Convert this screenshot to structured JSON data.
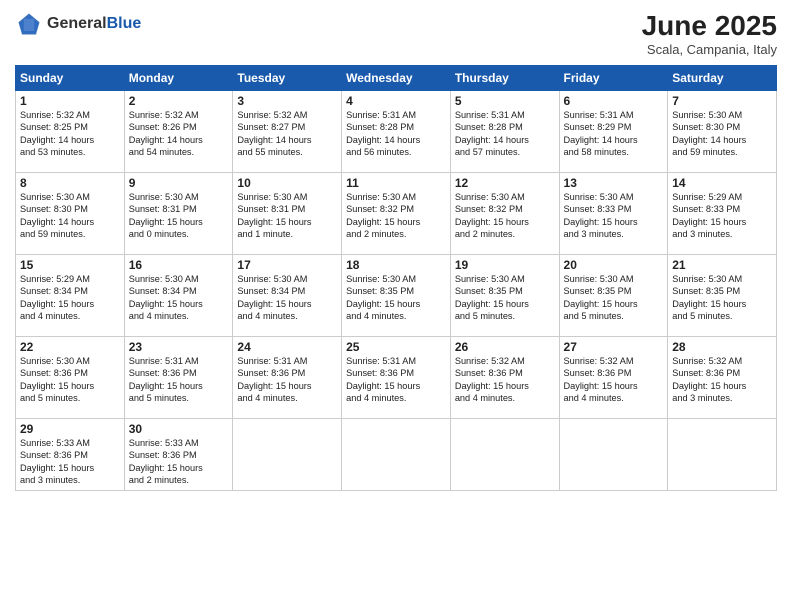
{
  "header": {
    "logo_general": "General",
    "logo_blue": "Blue",
    "month_year": "June 2025",
    "location": "Scala, Campania, Italy"
  },
  "days_of_week": [
    "Sunday",
    "Monday",
    "Tuesday",
    "Wednesday",
    "Thursday",
    "Friday",
    "Saturday"
  ],
  "weeks": [
    [
      {
        "day": "1",
        "text": "Sunrise: 5:32 AM\nSunset: 8:25 PM\nDaylight: 14 hours\nand 53 minutes."
      },
      {
        "day": "2",
        "text": "Sunrise: 5:32 AM\nSunset: 8:26 PM\nDaylight: 14 hours\nand 54 minutes."
      },
      {
        "day": "3",
        "text": "Sunrise: 5:32 AM\nSunset: 8:27 PM\nDaylight: 14 hours\nand 55 minutes."
      },
      {
        "day": "4",
        "text": "Sunrise: 5:31 AM\nSunset: 8:28 PM\nDaylight: 14 hours\nand 56 minutes."
      },
      {
        "day": "5",
        "text": "Sunrise: 5:31 AM\nSunset: 8:28 PM\nDaylight: 14 hours\nand 57 minutes."
      },
      {
        "day": "6",
        "text": "Sunrise: 5:31 AM\nSunset: 8:29 PM\nDaylight: 14 hours\nand 58 minutes."
      },
      {
        "day": "7",
        "text": "Sunrise: 5:30 AM\nSunset: 8:30 PM\nDaylight: 14 hours\nand 59 minutes."
      }
    ],
    [
      {
        "day": "8",
        "text": "Sunrise: 5:30 AM\nSunset: 8:30 PM\nDaylight: 14 hours\nand 59 minutes."
      },
      {
        "day": "9",
        "text": "Sunrise: 5:30 AM\nSunset: 8:31 PM\nDaylight: 15 hours\nand 0 minutes."
      },
      {
        "day": "10",
        "text": "Sunrise: 5:30 AM\nSunset: 8:31 PM\nDaylight: 15 hours\nand 1 minute."
      },
      {
        "day": "11",
        "text": "Sunrise: 5:30 AM\nSunset: 8:32 PM\nDaylight: 15 hours\nand 2 minutes."
      },
      {
        "day": "12",
        "text": "Sunrise: 5:30 AM\nSunset: 8:32 PM\nDaylight: 15 hours\nand 2 minutes."
      },
      {
        "day": "13",
        "text": "Sunrise: 5:30 AM\nSunset: 8:33 PM\nDaylight: 15 hours\nand 3 minutes."
      },
      {
        "day": "14",
        "text": "Sunrise: 5:29 AM\nSunset: 8:33 PM\nDaylight: 15 hours\nand 3 minutes."
      }
    ],
    [
      {
        "day": "15",
        "text": "Sunrise: 5:29 AM\nSunset: 8:34 PM\nDaylight: 15 hours\nand 4 minutes."
      },
      {
        "day": "16",
        "text": "Sunrise: 5:30 AM\nSunset: 8:34 PM\nDaylight: 15 hours\nand 4 minutes."
      },
      {
        "day": "17",
        "text": "Sunrise: 5:30 AM\nSunset: 8:34 PM\nDaylight: 15 hours\nand 4 minutes."
      },
      {
        "day": "18",
        "text": "Sunrise: 5:30 AM\nSunset: 8:35 PM\nDaylight: 15 hours\nand 4 minutes."
      },
      {
        "day": "19",
        "text": "Sunrise: 5:30 AM\nSunset: 8:35 PM\nDaylight: 15 hours\nand 5 minutes."
      },
      {
        "day": "20",
        "text": "Sunrise: 5:30 AM\nSunset: 8:35 PM\nDaylight: 15 hours\nand 5 minutes."
      },
      {
        "day": "21",
        "text": "Sunrise: 5:30 AM\nSunset: 8:35 PM\nDaylight: 15 hours\nand 5 minutes."
      }
    ],
    [
      {
        "day": "22",
        "text": "Sunrise: 5:30 AM\nSunset: 8:36 PM\nDaylight: 15 hours\nand 5 minutes."
      },
      {
        "day": "23",
        "text": "Sunrise: 5:31 AM\nSunset: 8:36 PM\nDaylight: 15 hours\nand 5 minutes."
      },
      {
        "day": "24",
        "text": "Sunrise: 5:31 AM\nSunset: 8:36 PM\nDaylight: 15 hours\nand 4 minutes."
      },
      {
        "day": "25",
        "text": "Sunrise: 5:31 AM\nSunset: 8:36 PM\nDaylight: 15 hours\nand 4 minutes."
      },
      {
        "day": "26",
        "text": "Sunrise: 5:32 AM\nSunset: 8:36 PM\nDaylight: 15 hours\nand 4 minutes."
      },
      {
        "day": "27",
        "text": "Sunrise: 5:32 AM\nSunset: 8:36 PM\nDaylight: 15 hours\nand 4 minutes."
      },
      {
        "day": "28",
        "text": "Sunrise: 5:32 AM\nSunset: 8:36 PM\nDaylight: 15 hours\nand 3 minutes."
      }
    ],
    [
      {
        "day": "29",
        "text": "Sunrise: 5:33 AM\nSunset: 8:36 PM\nDaylight: 15 hours\nand 3 minutes."
      },
      {
        "day": "30",
        "text": "Sunrise: 5:33 AM\nSunset: 8:36 PM\nDaylight: 15 hours\nand 2 minutes."
      },
      {
        "day": "",
        "text": ""
      },
      {
        "day": "",
        "text": ""
      },
      {
        "day": "",
        "text": ""
      },
      {
        "day": "",
        "text": ""
      },
      {
        "day": "",
        "text": ""
      }
    ]
  ]
}
